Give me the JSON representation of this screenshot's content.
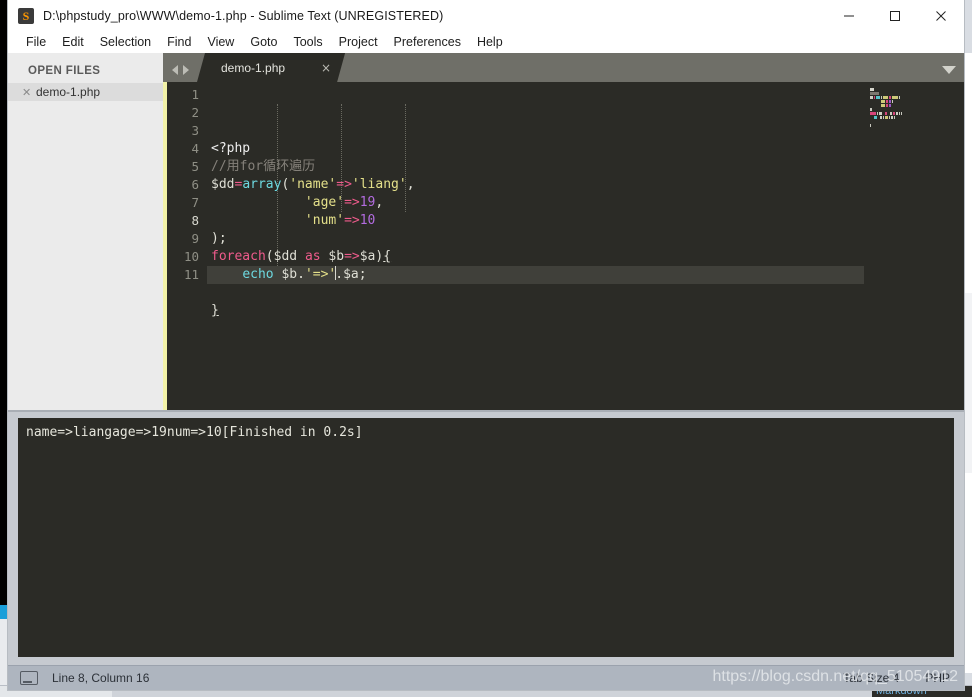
{
  "window": {
    "title": "D:\\phpstudy_pro\\WWW\\demo-1.php - Sublime Text (UNREGISTERED)",
    "app_icon": "sublime-text-icon",
    "minimize_label": "—",
    "maximize_label": "□",
    "close_label": "✕"
  },
  "menubar": {
    "items": [
      {
        "label": "File"
      },
      {
        "label": "Edit"
      },
      {
        "label": "Selection"
      },
      {
        "label": "Find"
      },
      {
        "label": "View"
      },
      {
        "label": "Goto"
      },
      {
        "label": "Tools"
      },
      {
        "label": "Project"
      },
      {
        "label": "Preferences"
      },
      {
        "label": "Help"
      }
    ]
  },
  "sidebar": {
    "title": "OPEN FILES",
    "files": [
      {
        "name": "demo-1.php",
        "close": "✕"
      }
    ]
  },
  "tabbar": {
    "nav_prev": "prev-tab-arrow",
    "nav_next": "next-tab-arrow",
    "tabs": [
      {
        "label": "demo-1.php",
        "close": "×",
        "active": true
      }
    ],
    "menu_icon": "chevron-down-icon"
  },
  "editor": {
    "active_line": 8,
    "line_numbers": [
      "1",
      "2",
      "3",
      "4",
      "5",
      "6",
      "7",
      "8",
      "9",
      "10",
      "11"
    ],
    "lines": [
      {
        "n": 1,
        "tokens": [
          {
            "t": "<?php",
            "c": "t-tag"
          }
        ]
      },
      {
        "n": 2,
        "tokens": [
          {
            "t": "//用for循环遍历",
            "c": "t-comment"
          }
        ]
      },
      {
        "n": 3,
        "tokens": [
          {
            "t": "$dd",
            "c": "t-var"
          },
          {
            "t": "=",
            "c": "t-op"
          },
          {
            "t": "array",
            "c": "t-func"
          },
          {
            "t": "(",
            "c": "t-punct"
          },
          {
            "t": "'name'",
            "c": "t-str"
          },
          {
            "t": "=>",
            "c": "t-op"
          },
          {
            "t": "'liang'",
            "c": "t-str"
          },
          {
            "t": ",",
            "c": "t-punct"
          }
        ]
      },
      {
        "n": 4,
        "tokens": [
          {
            "t": "            ",
            "c": "t-plain"
          },
          {
            "t": "'age'",
            "c": "t-str"
          },
          {
            "t": "=>",
            "c": "t-op"
          },
          {
            "t": "19",
            "c": "t-num"
          },
          {
            "t": ",",
            "c": "t-punct"
          }
        ]
      },
      {
        "n": 5,
        "tokens": [
          {
            "t": "            ",
            "c": "t-plain"
          },
          {
            "t": "'num'",
            "c": "t-str"
          },
          {
            "t": "=>",
            "c": "t-op"
          },
          {
            "t": "10",
            "c": "t-num"
          }
        ]
      },
      {
        "n": 6,
        "tokens": [
          {
            "t": ");",
            "c": "t-punct"
          }
        ]
      },
      {
        "n": 7,
        "tokens": [
          {
            "t": "foreach",
            "c": "t-kw"
          },
          {
            "t": "(",
            "c": "t-punct"
          },
          {
            "t": "$dd",
            "c": "t-var"
          },
          {
            "t": " ",
            "c": "t-plain"
          },
          {
            "t": "as",
            "c": "t-kw"
          },
          {
            "t": " ",
            "c": "t-plain"
          },
          {
            "t": "$b",
            "c": "t-var"
          },
          {
            "t": "=>",
            "c": "t-op"
          },
          {
            "t": "$a",
            "c": "t-var"
          },
          {
            "t": ")",
            "c": "t-punct"
          },
          {
            "t": "{",
            "c": "t-brace"
          }
        ]
      },
      {
        "n": 8,
        "tokens": [
          {
            "t": "    ",
            "c": "t-plain"
          },
          {
            "t": "echo",
            "c": "t-func"
          },
          {
            "t": " ",
            "c": "t-plain"
          },
          {
            "t": "$b",
            "c": "t-var"
          },
          {
            "t": ".",
            "c": "t-punct"
          },
          {
            "t": "'=>'",
            "c": "t-str"
          },
          {
            "t": ".",
            "c": "t-punct"
          },
          {
            "t": "$a",
            "c": "t-var"
          },
          {
            "t": ";",
            "c": "t-punct"
          }
        ]
      },
      {
        "n": 9,
        "tokens": []
      },
      {
        "n": 10,
        "tokens": [
          {
            "t": "}",
            "c": "t-brace"
          }
        ]
      },
      {
        "n": 11,
        "tokens": []
      }
    ]
  },
  "console": {
    "output": "name=>liangage=>19num=>10[Finished in 0.2s]"
  },
  "statusbar": {
    "left_icon": "console-toggle-icon",
    "position": "Line 8, Column 16",
    "tab_size": "Tab Size 4",
    "syntax": "PHP",
    "watermark": "https://blog.csdn.net/qq_51054912"
  },
  "background": {
    "markdown_hint": "Markdown"
  },
  "colors": {
    "editor_bg": "#2b2b26",
    "dirty_strip": "#f2f2a8",
    "tab_inactive_bg": "#6f6f68",
    "statusbar_bg": "#aeb5bf",
    "accent_orange": "#ff9800"
  }
}
